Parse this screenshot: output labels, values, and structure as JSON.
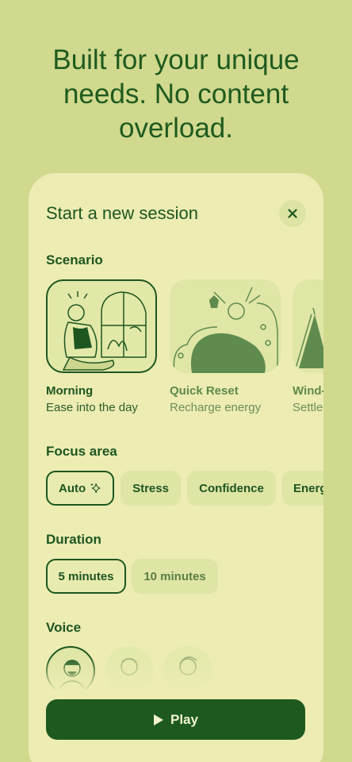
{
  "headline": "Built for your unique needs. No content overload.",
  "session": {
    "title": "Start a new session",
    "close_icon": "close-icon"
  },
  "scenario": {
    "label": "Scenario",
    "items": [
      {
        "title": "Morning",
        "subtitle": "Ease into the day",
        "selected": true
      },
      {
        "title": "Quick Reset",
        "subtitle": "Recharge energy",
        "selected": false
      },
      {
        "title": "Wind-",
        "subtitle": "Settle",
        "selected": false
      }
    ]
  },
  "focus": {
    "label": "Focus area",
    "chips": [
      {
        "label": "Auto",
        "selected": true,
        "icon": "sparkle-icon"
      },
      {
        "label": "Stress",
        "selected": false
      },
      {
        "label": "Confidence",
        "selected": false
      },
      {
        "label": "Energ",
        "selected": false
      }
    ]
  },
  "duration": {
    "label": "Duration",
    "chips": [
      {
        "label": "5 minutes",
        "selected": true
      },
      {
        "label": "10 minutes",
        "selected": false
      }
    ]
  },
  "voice": {
    "label": "Voice",
    "avatars": [
      "voice-avatar-1",
      "voice-avatar-2",
      "voice-avatar-3"
    ]
  },
  "play": {
    "label": "Play",
    "icon": "play-icon"
  },
  "colors": {
    "background": "#d0d98e",
    "card": "#ececb3",
    "accent": "#1e5620",
    "chip": "#dfe5a5"
  }
}
